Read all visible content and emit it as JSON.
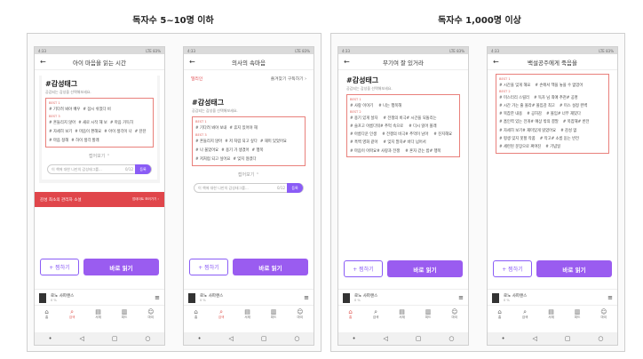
{
  "headers": {
    "left": "독자수 5~10명 이하",
    "right": "독자수 1,000명 이상"
  },
  "phones": [
    {
      "title": "아이 마음을 읽는 시간",
      "tag_title": "#감성태그",
      "tag_sub": "공감되는 감성을 선택해보세요.",
      "best_labels": [
        "BEST 1",
        "BEST 2",
        "BEST 3"
      ],
      "tags": [
        "# 기다려 봐야 배우",
        "# 잠시 쉬었다 비",
        "# 흔들리지 않아",
        "# 새로 시작 해 보",
        "# 마음 가득히",
        "# 자세히 보기",
        "# 마음이 편해요",
        "# 아이 생각이 나",
        "# 잔잔",
        "# 마음 정해",
        "# 하이 생각 할래"
      ],
      "more": "접어보기 ⌃",
      "input_placeholder": "이 책에 대한 나만의 감성태그를...",
      "input_count": "0/12",
      "register": "등록",
      "banner_left": "감성 최소의 관리자 소설",
      "banner_right": "업데이트 보러가기 ›",
      "wish": "+ 찜하기",
      "read": "바로 읽기",
      "mini_title": "로노 사파랜스",
      "mini_sub": "0 %"
    },
    {
      "title": "의사의 속마음",
      "promo_left": "밀리인",
      "promo_right": "즐겨찾기 구독하기 ›",
      "tag_title": "#감성태그",
      "tag_sub": "공감되는 감성을 선택해보세요.",
      "best_labels": [
        "BEST 1",
        "BEST 2",
        "BEST 3"
      ],
      "tags": [
        "# 기다려 봐야 보내",
        "# 휴지 있어야 해",
        "# 흔들리지 않아",
        "# 저 처럼 되고 싶다",
        "# 재미 있었어요",
        "# 나 울었어요",
        "# 용기 가 생겼어",
        "# 행복",
        "# 저처럼 되고 싶어요",
        "# 잊지 않겠다"
      ],
      "more": "접어보기 ⌃",
      "input_placeholder": "이 책에 대한 나만의 감성태그를...",
      "input_count": "0/12",
      "register": "등록",
      "wish": "+ 찜하기",
      "read": "바로 읽기",
      "mini_title": "로노 사파랜스",
      "mini_sub": "0 %"
    },
    {
      "title": "무기여 잘 있거라",
      "tag_title": "#감성태그",
      "tag_sub": "공감되는 감성을 선택해보세요.",
      "best_labels": [
        "BEST 1",
        "BEST 2",
        "BEST 3"
      ],
      "tags": [
        "# 사랑 이야기",
        "# 나는 행복해",
        "# 용기 있게 살자",
        "# 전쟁의 비극",
        "# 시간을 되돌리는",
        "# 슬프고 아름다워",
        "# 추억 속으로",
        "# 다시 읽어 볼래",
        "# 아름다운 인생",
        "# 전쟁의 비극",
        "# 추억이 남아",
        "# 진지해요",
        "# 흑백 영화 같아",
        "# 잊지 말자",
        "# 바다 넘어서",
        "# 마음이 아파요",
        "# 사랑과 전쟁",
        "# 혼자 걷는 밤",
        "# 행복"
      ],
      "wish": "+ 찜하기",
      "read": "바로 읽기",
      "mini_title": "로노 사파랜스",
      "mini_sub": "0 %"
    },
    {
      "title": "백설공주에게 죽음을",
      "tag_title": "",
      "tag_sub": "",
      "best_labels": [
        "BEST 1",
        "BEST 2",
        "BEST 3"
      ],
      "tags": [
        "# 시간을 잊게 해요",
        "# 손에서 책을 놓을 수 없었어",
        "# 미스터리 스릴러",
        "# 독자 님 최애 추천",
        "# 공명",
        "# 시간 가는 줄 몰라",
        "# 몰입감 최고",
        "# 미스 설정 완벽",
        "# 복잡한 내용",
        "# 공허감",
        "# 몰입",
        "# 너무 재밌다",
        "# 흡인력 있는 전개",
        "# 예상 밖의 결말",
        "# 복잡해",
        "# 반전",
        "# 자세히 보기",
        "# 재미있게 읽었어요",
        "# 감성 없",
        "# 평생 잊지 못할 작품",
        "# 작고",
        "# 소름 돋는 반전",
        "# 세련된 문장으로 짜여진",
        "# 기념일"
      ],
      "wish": "+ 찜하기",
      "read": "바로 읽기",
      "mini_title": "로노 사파랜스",
      "mini_sub": "0 %"
    }
  ],
  "tabs": [
    "홈",
    "검색",
    "서재",
    "피드",
    "마이"
  ],
  "status": {
    "time": "4:33",
    "right": "LTE 83%"
  },
  "colors": {
    "accent": "#9a5cf0",
    "tag_border": "#e9807b",
    "banner": "#e0464b"
  }
}
